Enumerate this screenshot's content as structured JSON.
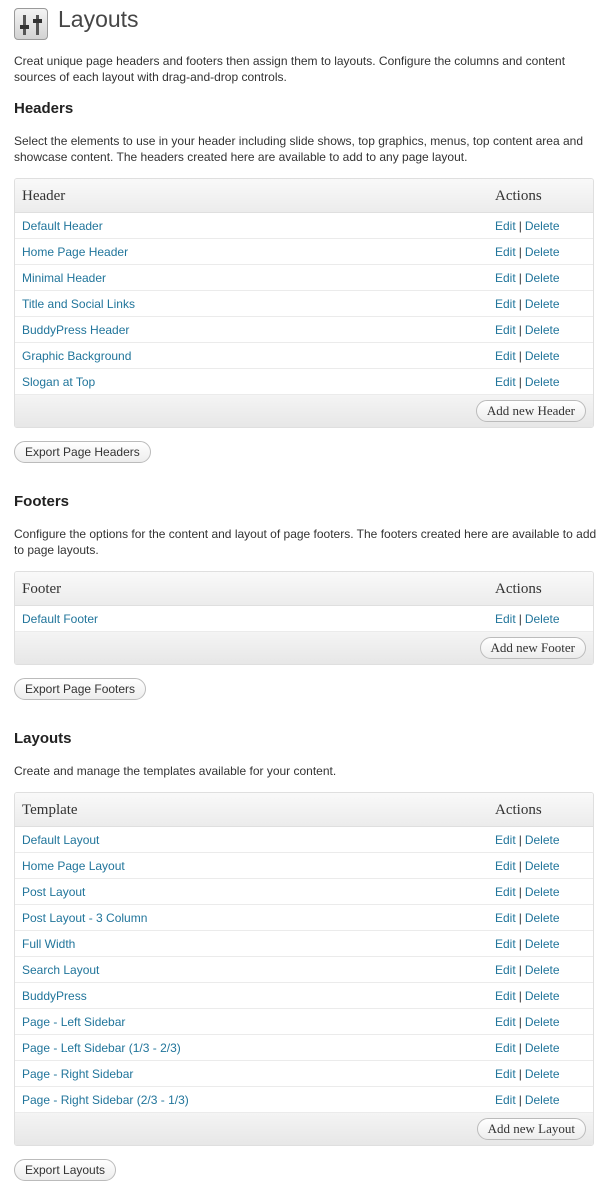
{
  "page": {
    "title": "Layouts",
    "intro": "Creat unique page headers and footers then assign them to layouts. Configure the columns and content sources of each layout with drag-and-drop controls."
  },
  "headers": {
    "heading": "Headers",
    "description": "Select the elements to use in your header including slide shows, top graphics, menus, top content area and showcase content. The headers created here are available to add to any page layout.",
    "col_name": "Header",
    "col_actions": "Actions",
    "rows": [
      "Default Header",
      "Home Page Header",
      "Minimal Header",
      "Title and Social Links",
      "BuddyPress Header",
      "Graphic Background",
      "Slogan at Top"
    ],
    "add_button": "Add new Header",
    "export_button": "Export Page Headers"
  },
  "footers": {
    "heading": "Footers",
    "description": "Configure the options for the content and layout of page footers. The footers created here are available to add to page layouts.",
    "col_name": "Footer",
    "col_actions": "Actions",
    "rows": [
      "Default Footer"
    ],
    "add_button": "Add new Footer",
    "export_button": "Export Page Footers"
  },
  "layouts": {
    "heading": "Layouts",
    "description": "Create and manage the templates available for your content.",
    "col_name": "Template",
    "col_actions": "Actions",
    "rows": [
      "Default Layout",
      "Home Page Layout",
      "Post Layout",
      "Post Layout - 3 Column",
      "Full Width",
      "Search Layout",
      "BuddyPress",
      "Page - Left Sidebar",
      "Page - Left Sidebar (1/3 - 2/3)",
      "Page - Right Sidebar",
      "Page - Right Sidebar (2/3 - 1/3)"
    ],
    "add_button": "Add new Layout",
    "export_button": "Export Layouts"
  },
  "actions": {
    "edit": "Edit",
    "separator": "|",
    "delete": "Delete"
  },
  "icons": {
    "page_icon": "layout-sliders-icon"
  },
  "colors": {
    "link": "#21759b",
    "border": "#dfdfdf",
    "header_bg": "#ececec"
  }
}
